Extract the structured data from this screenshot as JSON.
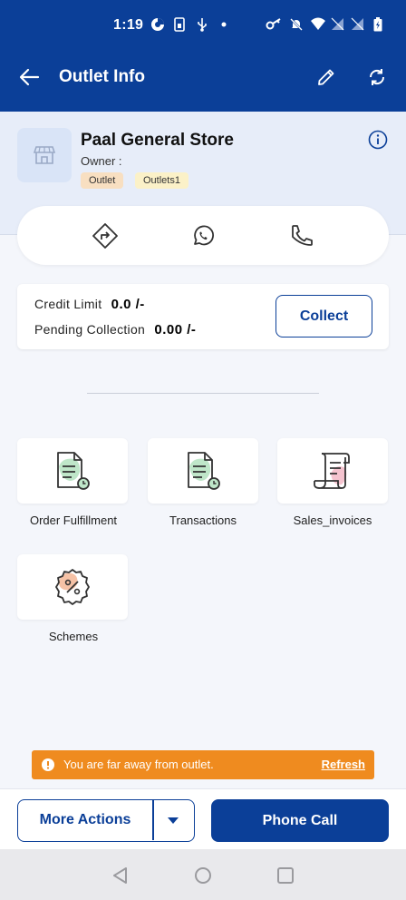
{
  "status_bar": {
    "time": "1:19",
    "icons": [
      "data-saver-icon",
      "sim-icon",
      "usb-icon",
      "dot-icon",
      "vpn-key-icon",
      "mute-icon",
      "wifi-icon",
      "signal-icon",
      "signal-icon",
      "battery-charging-icon"
    ]
  },
  "app_bar": {
    "title": "Outlet Info",
    "icons": [
      "back-arrow-icon",
      "edit-pencil-icon",
      "sync-icon"
    ]
  },
  "outlet": {
    "name": "Paal General Store",
    "owner_label": "Owner :",
    "tags": [
      "Outlet",
      "Outlets1"
    ],
    "icons": [
      "store-icon",
      "info-icon"
    ]
  },
  "contact": {
    "icons": [
      "directions-icon",
      "whatsapp-icon",
      "phone-icon"
    ]
  },
  "credit": {
    "credit_limit_label": "Credit Limit",
    "credit_limit_value": "0.0 /-",
    "pending_label": "Pending Collection",
    "pending_value": "0.00 /-",
    "collect_label": "Collect"
  },
  "tiles": [
    {
      "label": "Order Fulfillment",
      "icon": "order-document-icon"
    },
    {
      "label": "Transactions",
      "icon": "transactions-document-icon"
    },
    {
      "label": "Sales_invoices",
      "icon": "invoice-scroll-icon"
    },
    {
      "label": "Schemes",
      "icon": "discount-badge-icon"
    }
  ],
  "warning": {
    "message": "You are far away from outlet.",
    "action": "Refresh"
  },
  "bottom": {
    "more_actions": "More Actions",
    "phone_call": "Phone Call"
  },
  "colors": {
    "primary": "#0b3f98",
    "warning": "#ef8b1f",
    "header_bg": "#e7edf9"
  }
}
